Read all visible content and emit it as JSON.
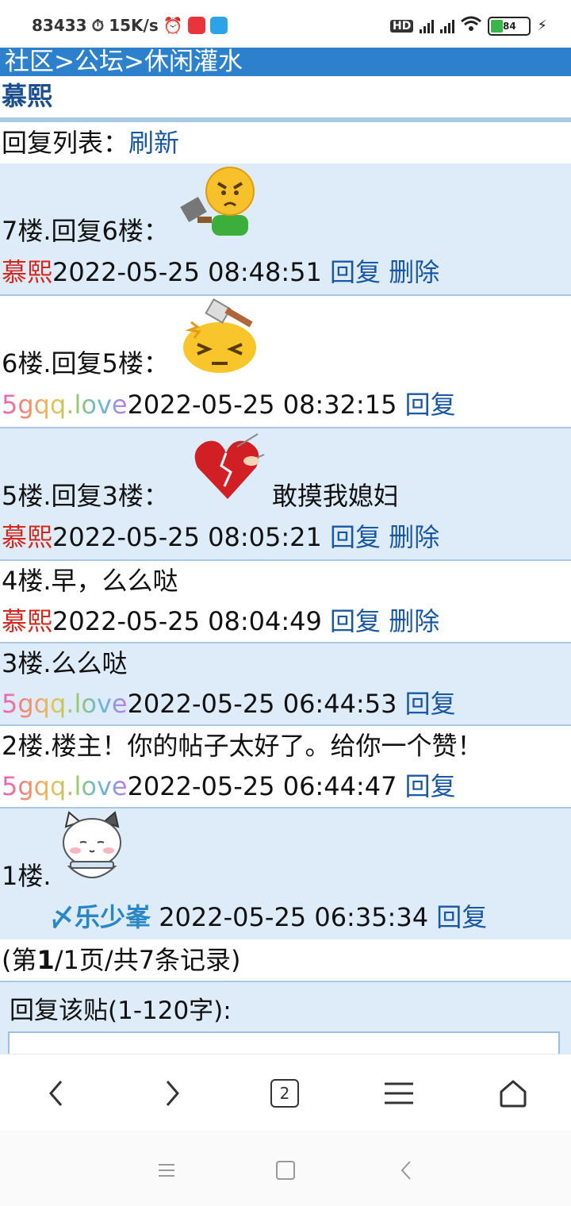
{
  "status_bar": {
    "left_text": "83433",
    "speed": "15K/s",
    "network": "HD",
    "battery": "84"
  },
  "breadcrumb": {
    "community": "社区",
    "forum": "公坛",
    "section": "休闲灌水",
    "sep": ">"
  },
  "post_author": "慕熙",
  "reply_list": {
    "label": "回复列表：",
    "refresh": "刷新"
  },
  "replies": [
    {
      "floor": "7楼.回复6楼：",
      "text": "",
      "emoji": "angry-cleaver-emoji",
      "user": "慕熙",
      "time": "2022-05-25 08:48:51",
      "reply": "回复",
      "delete": "删除"
    },
    {
      "floor": "6楼.回复5楼：",
      "text": "",
      "emoji": "hammer-hit-emoji",
      "user": "5gqq.love",
      "time": "2022-05-25 08:32:15",
      "reply": "回复"
    },
    {
      "floor": "5楼.回复3楼：",
      "text": "敢摸我媳妇",
      "emoji": "broken-heart-emoji",
      "user": "慕熙",
      "time": "2022-05-25 08:05:21",
      "reply": "回复",
      "delete": "删除"
    },
    {
      "floor": "4楼.早，么么哒",
      "user": "慕熙",
      "time": "2022-05-25 08:04:49",
      "reply": "回复",
      "delete": "删除"
    },
    {
      "floor": "3楼.么么哒",
      "user": "5gqq.love",
      "time": "2022-05-25 06:44:53",
      "reply": "回复"
    },
    {
      "floor": "2楼.楼主！你的帖子太好了。给你一个赞！",
      "user": "5gqq.love",
      "time": "2022-05-25 06:44:47",
      "reply": "回复"
    },
    {
      "floor": "1楼.",
      "emoji": "cat-bowl-sticker",
      "user": "〆乐少峯",
      "time": "2022-05-25 06:35:34",
      "reply": "回复"
    }
  ],
  "pagination": {
    "prefix": "(第",
    "current": "1",
    "suffix": "/1页/共7条记录)"
  },
  "reply_form": {
    "label": "回复该贴(1-120字):"
  },
  "browser_nav": {
    "tabs_count": "2"
  },
  "colors": {
    "header_blue": "#2d80cb",
    "alt_row": "#ddecf8",
    "link": "#1a57a3",
    "red_user": "#d6271e"
  }
}
